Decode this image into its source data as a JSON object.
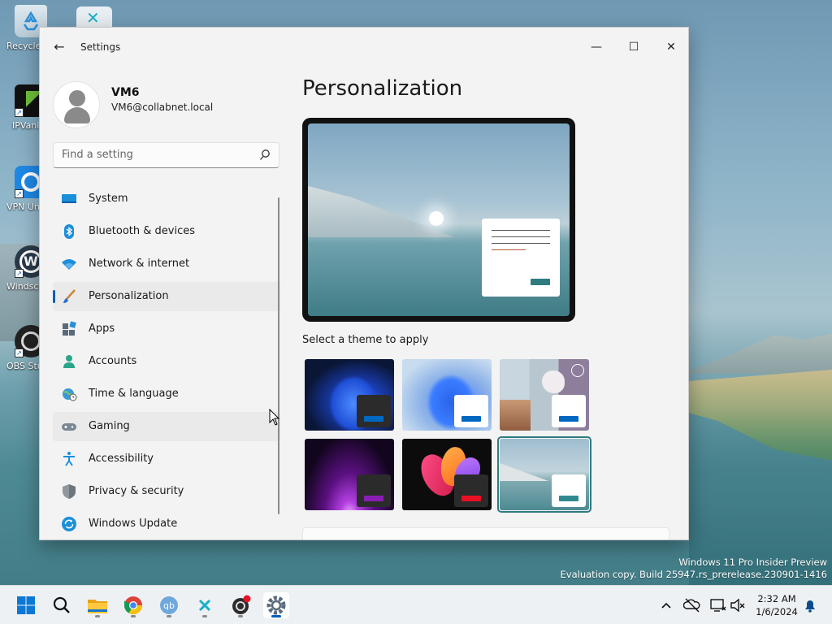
{
  "desktop": {
    "icons": [
      {
        "label": "Recycle Bin",
        "icon": "recycle-bin-icon"
      },
      {
        "label": "IPVanish",
        "icon": "ipvanish-icon"
      },
      {
        "label": "VPN Unlimited",
        "icon": "vpn-unlimited-icon"
      },
      {
        "label": "Windscribe",
        "icon": "windscribe-icon"
      },
      {
        "label": "OBS Studio",
        "icon": "obs-studio-icon"
      }
    ]
  },
  "window": {
    "title": "Settings",
    "minimize_symbol": "—",
    "maximize_symbol": "☐",
    "close_symbol": "✕",
    "back_symbol": "←"
  },
  "profile": {
    "name": "VM6",
    "email": "VM6@collabnet.local"
  },
  "search": {
    "placeholder": "Find a setting"
  },
  "nav": {
    "items": [
      {
        "label": "System",
        "icon": "system-icon"
      },
      {
        "label": "Bluetooth & devices",
        "icon": "bluetooth-icon"
      },
      {
        "label": "Network & internet",
        "icon": "wifi-icon"
      },
      {
        "label": "Personalization",
        "icon": "paintbrush-icon",
        "selected": true
      },
      {
        "label": "Apps",
        "icon": "apps-icon"
      },
      {
        "label": "Accounts",
        "icon": "person-icon"
      },
      {
        "label": "Time & language",
        "icon": "globe-clock-icon"
      },
      {
        "label": "Gaming",
        "icon": "gamepad-icon"
      },
      {
        "label": "Accessibility",
        "icon": "accessibility-icon"
      },
      {
        "label": "Privacy & security",
        "icon": "shield-icon"
      },
      {
        "label": "Windows Update",
        "icon": "update-icon"
      }
    ]
  },
  "main": {
    "page_title": "Personalization",
    "theme_heading": "Select a theme to apply",
    "themes": [
      {
        "name": "windows-dark",
        "accent": "#0067c0"
      },
      {
        "name": "windows-light",
        "accent": "#0067c0"
      },
      {
        "name": "captured-motion",
        "accent": "#0067c0"
      },
      {
        "name": "glow",
        "accent": "#8a1db5"
      },
      {
        "name": "flow",
        "accent": "#e81123"
      },
      {
        "name": "sunrise",
        "accent": "#2f8a8f",
        "selected": true
      }
    ]
  },
  "watermark": {
    "line1": "Windows 11 Pro Insider Preview",
    "line2": "Evaluation copy. Build 25947.rs_prerelease.230901-1416"
  },
  "taskbar": {
    "apps": [
      "start-icon",
      "search-icon",
      "file-explorer-icon",
      "chrome-icon",
      "qbittorrent-icon",
      "app-x-icon",
      "obs-icon",
      "settings-icon"
    ],
    "time": "2:32 AM",
    "date": "1/6/2024"
  },
  "colors": {
    "accent": "#005fb8",
    "window_bg": "#f3f3f3"
  }
}
